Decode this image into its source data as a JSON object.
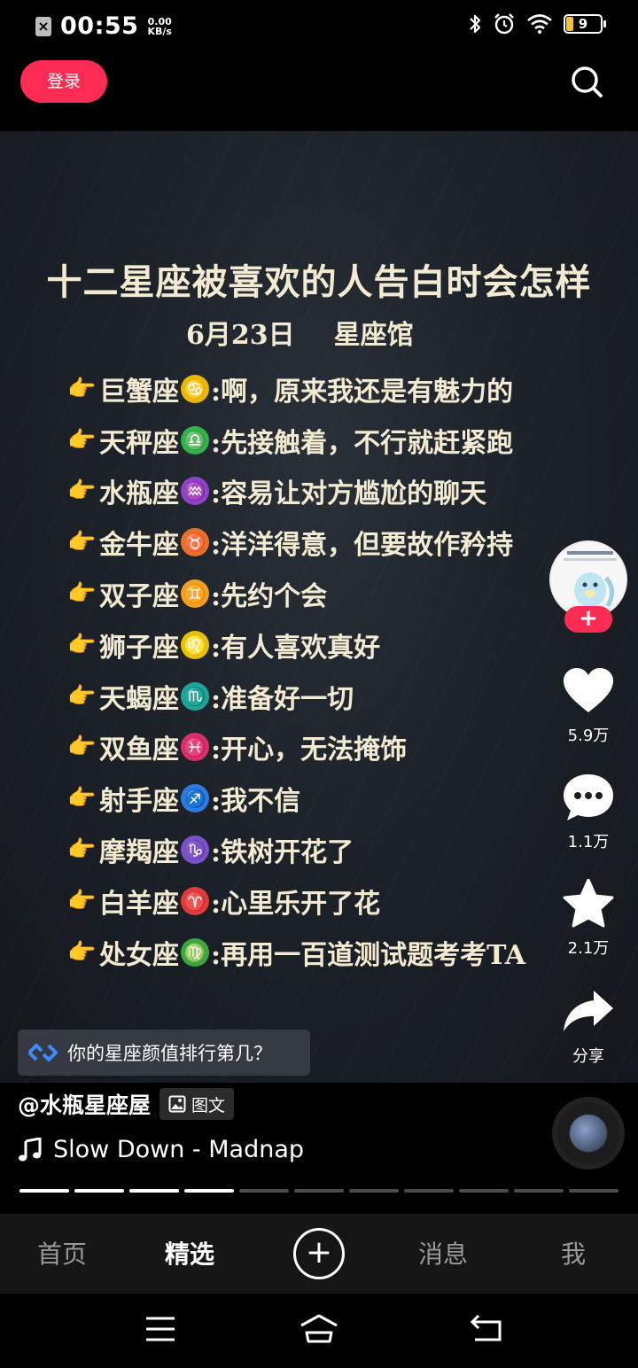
{
  "status_bar": {
    "time": "00:55",
    "net_speed_value": "0.00",
    "net_speed_unit": "KB/s",
    "battery": "9"
  },
  "top_bar": {
    "login_label": "登录"
  },
  "post": {
    "title": "十二星座被喜欢的人告白时会怎样",
    "date": "6月23日",
    "source": "星座馆",
    "items": [
      {
        "sign": "巨蟹座",
        "symbol": "♋",
        "color": "#e6b800",
        "text": ":啊，原来我还是有魅力的"
      },
      {
        "sign": "天秤座",
        "symbol": "♎",
        "color": "#2fb44a",
        "text": ":先接触着，不行就赶紧跑"
      },
      {
        "sign": "水瓶座",
        "symbol": "♒",
        "color": "#8e44c8",
        "text": ":容易让对方尴尬的聊天"
      },
      {
        "sign": "金牛座",
        "symbol": "♉",
        "color": "#e8712a",
        "text": ":洋洋得意，但要故作矜持"
      },
      {
        "sign": "双子座",
        "symbol": "♊",
        "color": "#f0a020",
        "text": ":先约个会"
      },
      {
        "sign": "狮子座",
        "symbol": "♌",
        "color": "#e6c200",
        "text": ":有人喜欢真好"
      },
      {
        "sign": "天蝎座",
        "symbol": "♏",
        "color": "#1ea59a",
        "text": ":准备好一切"
      },
      {
        "sign": "双鱼座",
        "symbol": "♓",
        "color": "#d8306a",
        "text": ":开心，无法掩饰"
      },
      {
        "sign": "射手座",
        "symbol": "♐",
        "color": "#2d7be0",
        "text": ":我不信"
      },
      {
        "sign": "摩羯座",
        "symbol": "♑",
        "color": "#7a52c8",
        "text": ":铁树开花了"
      },
      {
        "sign": "白羊座",
        "symbol": "♈",
        "color": "#e03a3a",
        "text": ":心里乐开了花"
      },
      {
        "sign": "处女座",
        "symbol": "♍",
        "color": "#3aa840",
        "text": ":再用一百道测试题考考TA"
      }
    ]
  },
  "rail": {
    "follow_label": "+",
    "like_count": "5.9万",
    "comment_count": "1.1万",
    "favorite_count": "2.1万",
    "share_label": "分享"
  },
  "related": {
    "text": "你的星座颜值排行第几？"
  },
  "author": {
    "name": "@水瓶星座屋",
    "badge": "图文"
  },
  "music": {
    "title": "Slow Down - Madnap"
  },
  "carousel": {
    "total": 11,
    "current": 4
  },
  "tabs": {
    "home": "首页",
    "featured": "精选",
    "messages": "消息",
    "me": "我",
    "active": "精选"
  },
  "colors": {
    "accent": "#fe2c55",
    "text_warm": "#f3ead2"
  },
  "icons": [
    "search-icon",
    "heart-icon",
    "comment-icon",
    "star-icon",
    "share-icon",
    "music-note-icon",
    "image-icon",
    "link-icon",
    "plus-icon",
    "menu-icon",
    "home-icon",
    "back-icon"
  ]
}
